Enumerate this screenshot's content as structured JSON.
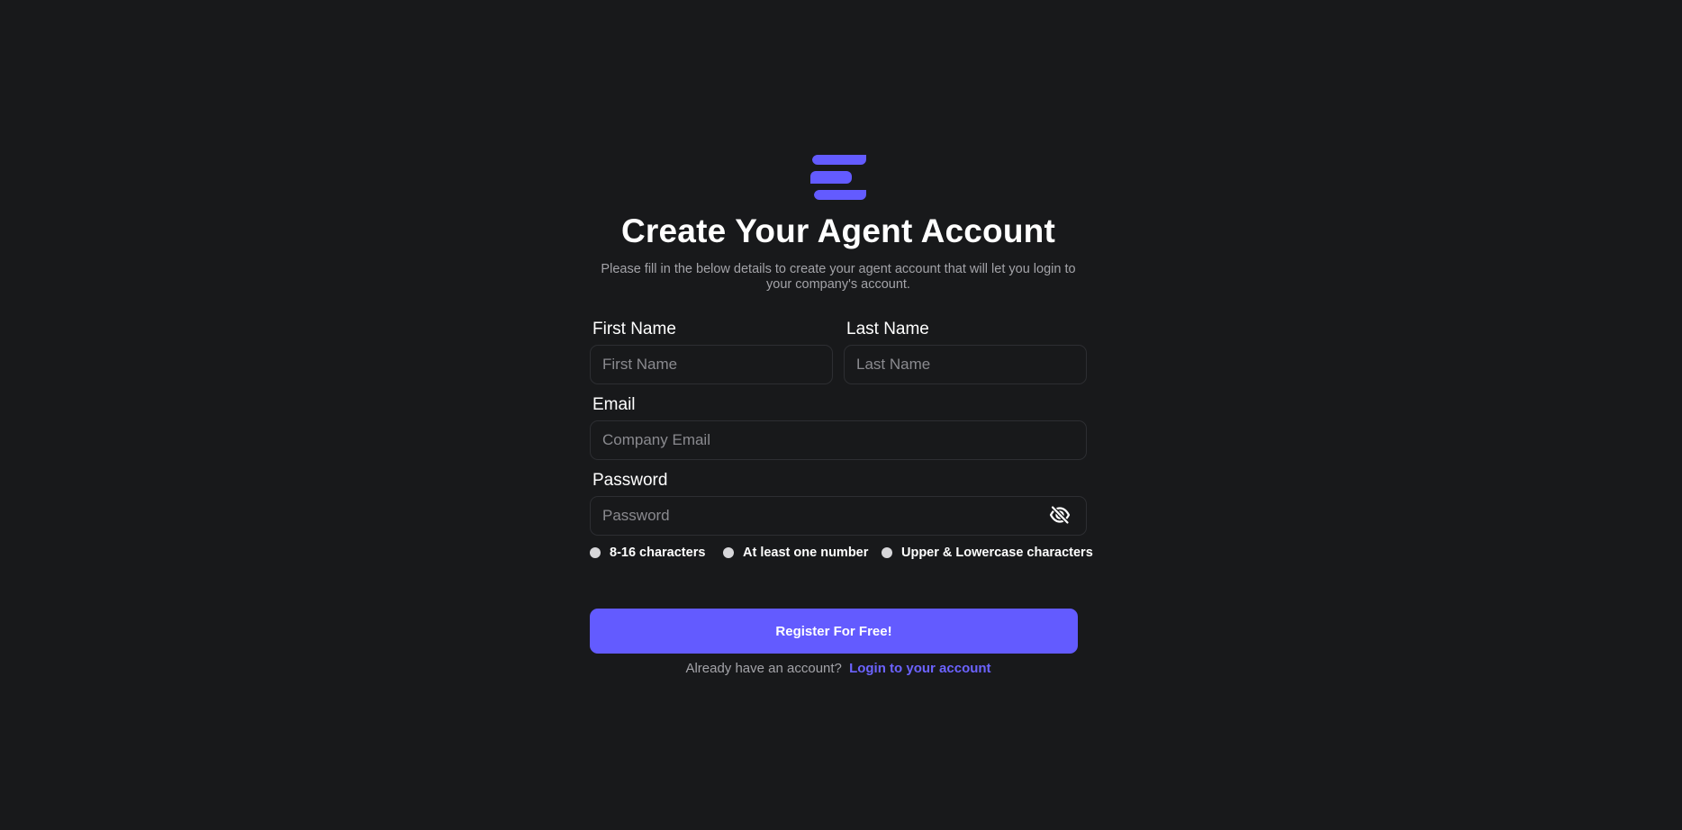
{
  "brand": {
    "logo_icon": "stacked-bars-logo",
    "accent_color": "#635bff"
  },
  "header": {
    "title": "Create Your Agent Account",
    "subtitle": "Please fill in the below details to create your agent account that will let you login to your company's account."
  },
  "form": {
    "first_name": {
      "label": "First Name",
      "placeholder": "First Name",
      "value": ""
    },
    "last_name": {
      "label": "Last Name",
      "placeholder": "Last Name",
      "value": ""
    },
    "email": {
      "label": "Email",
      "placeholder": "Company Email",
      "value": ""
    },
    "password": {
      "label": "Password",
      "placeholder": "Password",
      "value": "",
      "toggle_icon": "eye-slash-icon"
    },
    "requirements": [
      {
        "label": "8-16 characters"
      },
      {
        "label": "At least one number"
      },
      {
        "label": "Upper & Lowercase characters"
      }
    ],
    "submit_label": "Register For Free!"
  },
  "footer": {
    "prompt": "Already have an account?",
    "login_link": "Login to your account"
  }
}
